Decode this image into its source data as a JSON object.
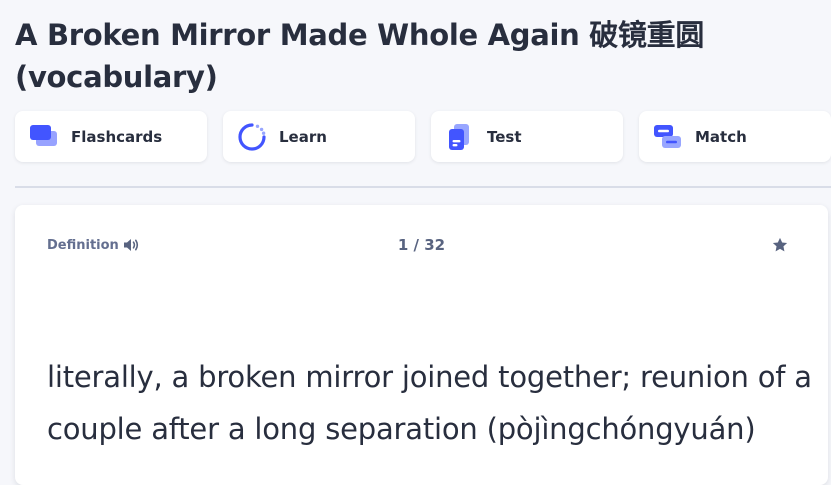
{
  "page": {
    "title": "A Broken Mirror Made Whole Again 破镜重圆 (vocabulary)"
  },
  "study_modes": [
    {
      "label": "Flashcards",
      "icon": "flashcards-icon"
    },
    {
      "label": "Learn",
      "icon": "learn-icon"
    },
    {
      "label": "Test",
      "icon": "test-icon"
    },
    {
      "label": "Match",
      "icon": "match-icon"
    }
  ],
  "card": {
    "side_label": "Definition",
    "counter": "1 / 32",
    "text": "literally, a broken mirror joined together; reunion of a couple after a long separation (pòjìngchóngyuán)"
  },
  "colors": {
    "accent": "#4255ff",
    "accent_light": "#98a6ff",
    "background": "#f6f7fb",
    "text": "#282e3e",
    "muted": "#646f90"
  }
}
